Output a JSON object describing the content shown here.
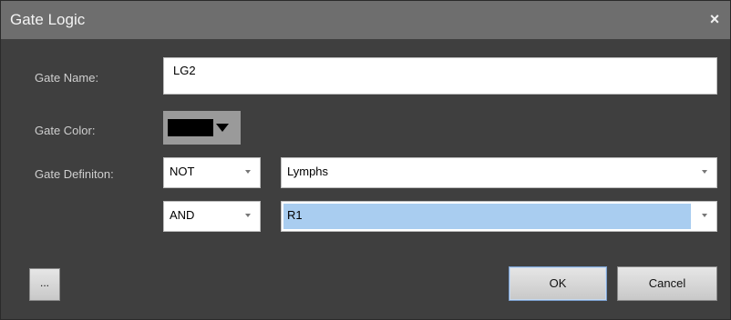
{
  "window": {
    "title": "Gate Logic",
    "close_glyph": "×"
  },
  "form": {
    "gate_name_label": "Gate Name:",
    "gate_name_value": "LG2",
    "gate_color_label": "Gate Color:",
    "gate_color_value": "#000000",
    "gate_definition_label": "Gate Definiton:",
    "rows": [
      {
        "operator": "NOT",
        "gate": "Lymphs"
      },
      {
        "operator": "AND",
        "gate": "R1",
        "highlighted": true
      }
    ]
  },
  "buttons": {
    "more_label": "...",
    "ok_label": "OK",
    "cancel_label": "Cancel"
  },
  "icons": {
    "close": "close-icon",
    "dropdown": "chevron-down-icon"
  }
}
